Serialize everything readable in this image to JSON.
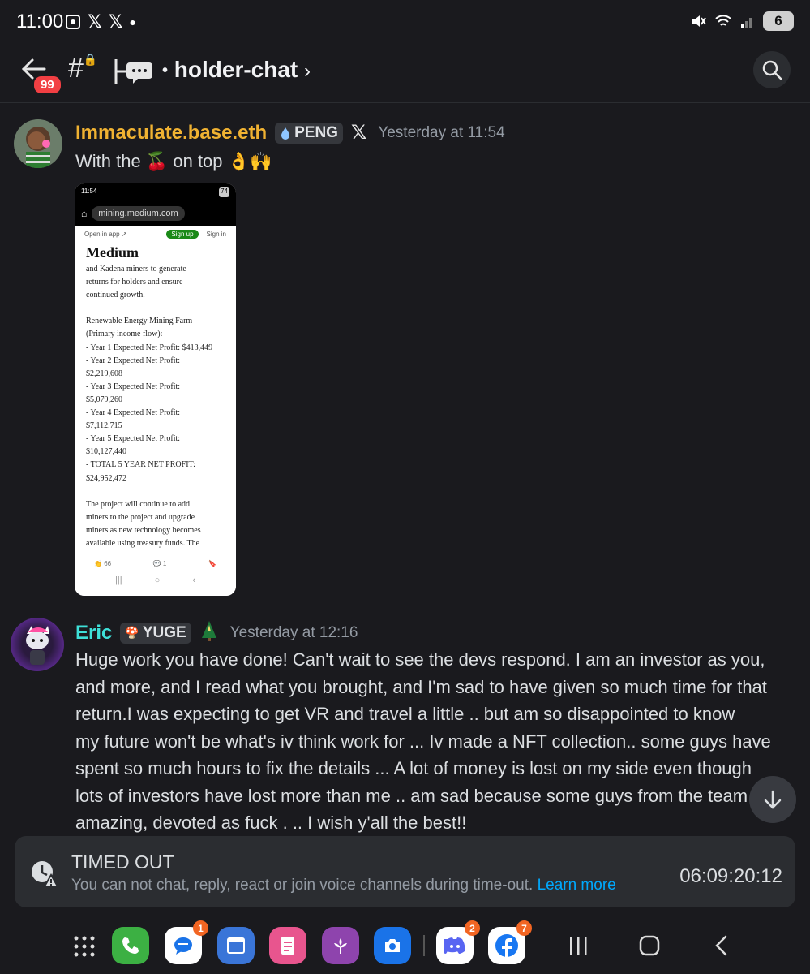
{
  "status_bar": {
    "time": "11:00",
    "battery": "6"
  },
  "header": {
    "unread_badge": "99",
    "channel_name": "holder-chat"
  },
  "messages": [
    {
      "username": "Immaculate.base.eth",
      "username_color": "#f0b232",
      "tag": "PENG",
      "timestamp": "Yesterday at 11:54",
      "text_before": "With the",
      "text_after": "on top",
      "attachment": {
        "status_time": "11:54",
        "status_battery": "74",
        "url": "mining.medium.com",
        "open_in_app": "Open in app ↗",
        "sign_up": "Sign up",
        "sign_in": "Sign in",
        "logo": "Medium",
        "lines": [
          "and Kadena miners to generate",
          "returns for holders and ensure",
          "continued growth.",
          "",
          "Renewable Energy Mining Farm",
          "(Primary income flow):",
          "- Year 1 Expected Net Profit: $413,449",
          "- Year 2 Expected Net Profit:",
          "$2,219,608",
          "- Year 3 Expected Net Profit:",
          "$5,079,260",
          "- Year 4 Expected Net Profit:",
          "$7,112,715",
          "- Year 5 Expected Net Profit:",
          "$10,127,440",
          "- TOTAL 5 YEAR NET PROFIT:",
          "$24,952,472",
          "",
          "The project will continue to add",
          "miners to the project and upgrade",
          "miners as new technology becomes",
          "available using treasury funds. The"
        ],
        "claps": "66",
        "comments": "1"
      }
    },
    {
      "username": "Eric",
      "username_color": "#3ee0d8",
      "tag": "YUGE",
      "timestamp": "Yesterday at 12:16",
      "lines": [
        "Huge work you have done! Can't wait to see the devs respond. I am an investor as you,",
        "and more, and I read what you brought, and I'm sad to have given so much time for that",
        "return.I was expecting to get VR and travel a little .. but am so disappointed  to know",
        "my future won't be what's iv think work for ... Iv made a NFT collection.. some guys have",
        "spent so much hours to fix the details ... A lot of money is lost on my side even though",
        "lots of investors have lost more than me .. am sad because some guys from the team",
        "amazing, devoted as fuck . ..  I wish y'all the best!!"
      ]
    }
  ],
  "timeout": {
    "title": "TIMED OUT",
    "description": "You can not chat, reply, react or join voice channels during time-out.",
    "learn_more": "Learn more",
    "timer": "06:09:20:12"
  },
  "dock": {
    "messages_badge": "1",
    "discord_badge": "2",
    "facebook_badge": "7"
  },
  "colors": {
    "background": "#1a1a1e",
    "panel": "#2b2d31",
    "link": "#00a8fc",
    "badge_red": "#f23f43"
  }
}
